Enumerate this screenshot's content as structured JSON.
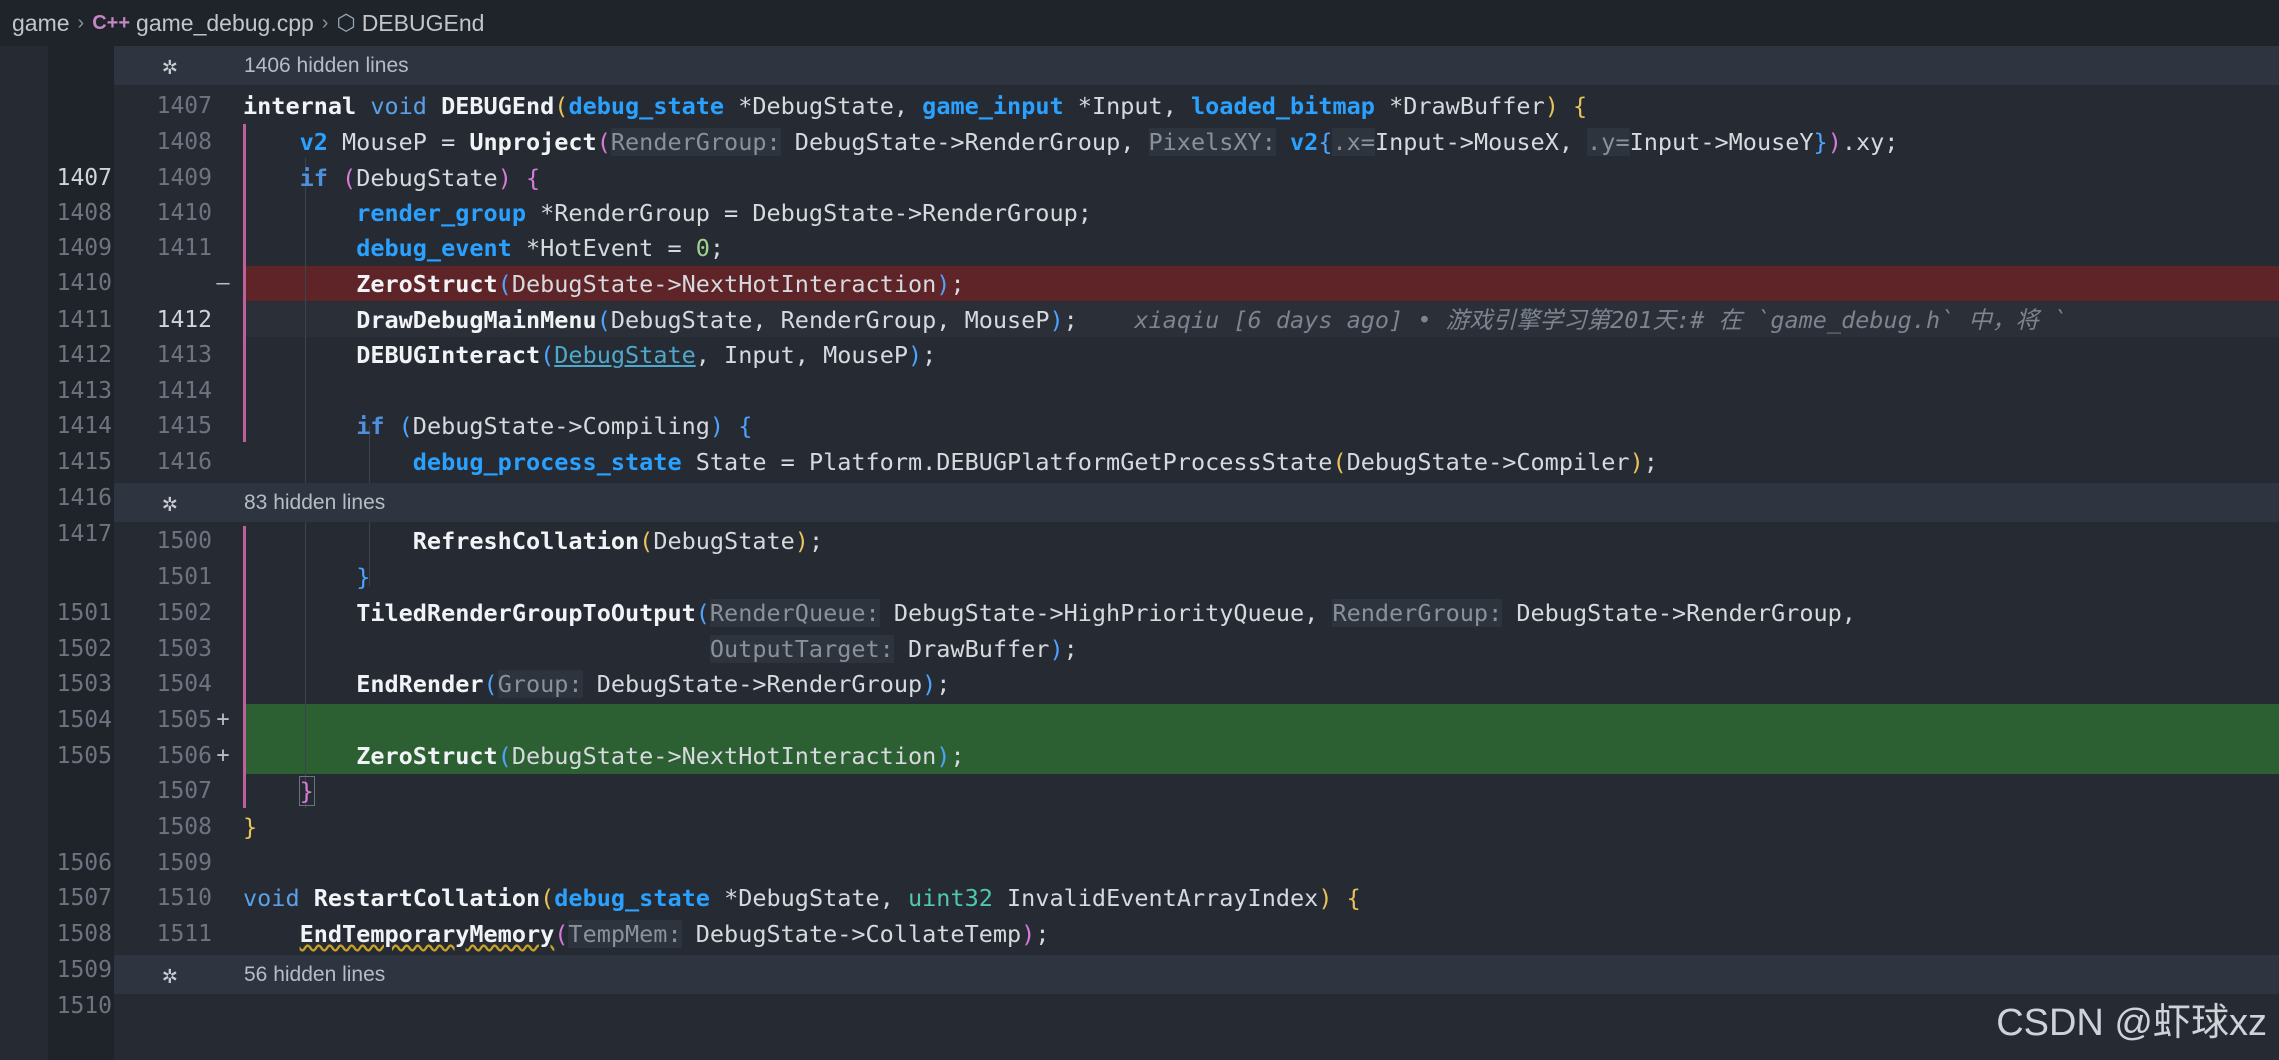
{
  "breadcrumb": {
    "folder": "game",
    "file": "game_debug.cpp",
    "symbol": "DEBUGEnd"
  },
  "icons": {
    "file_icon": "cpp-file-icon",
    "symbol_icon": "cube-icon",
    "fold_icon": "unfold-gear-icon"
  },
  "hidden": [
    {
      "label": "1406 hidden lines"
    },
    {
      "label": "83 hidden lines"
    },
    {
      "label": "56 hidden lines"
    }
  ],
  "left_numbers": [
    "1407",
    "1408",
    "1409",
    "1410",
    "1411",
    "1412",
    "1413",
    "1414",
    "1415",
    "1416",
    "1417",
    "1501",
    "1502",
    "1503",
    "1504",
    "1505",
    "1506",
    "1507",
    "1508",
    "1509",
    "1510"
  ],
  "right_numbers": [
    "1407",
    "1408",
    "1409",
    "1410",
    "1411",
    "1412",
    "1413",
    "1414",
    "1415",
    "1416",
    "1500",
    "1501",
    "1502",
    "1503",
    "1504",
    "1505",
    "1506",
    "1507",
    "1508",
    "1509",
    "1510",
    "1511"
  ],
  "markers": {
    "deleted": "—",
    "added": "+"
  },
  "blame": "xiaqiu [6 days ago] • 游戏引擎学习第201天:# 在 `game_debug.h` 中，将 `",
  "watermark": "CSDN @虾球xz",
  "colors": {
    "deleted_bg": "#5e2428",
    "added_bg": "#2c5f31",
    "editor_bg": "#262b33"
  }
}
